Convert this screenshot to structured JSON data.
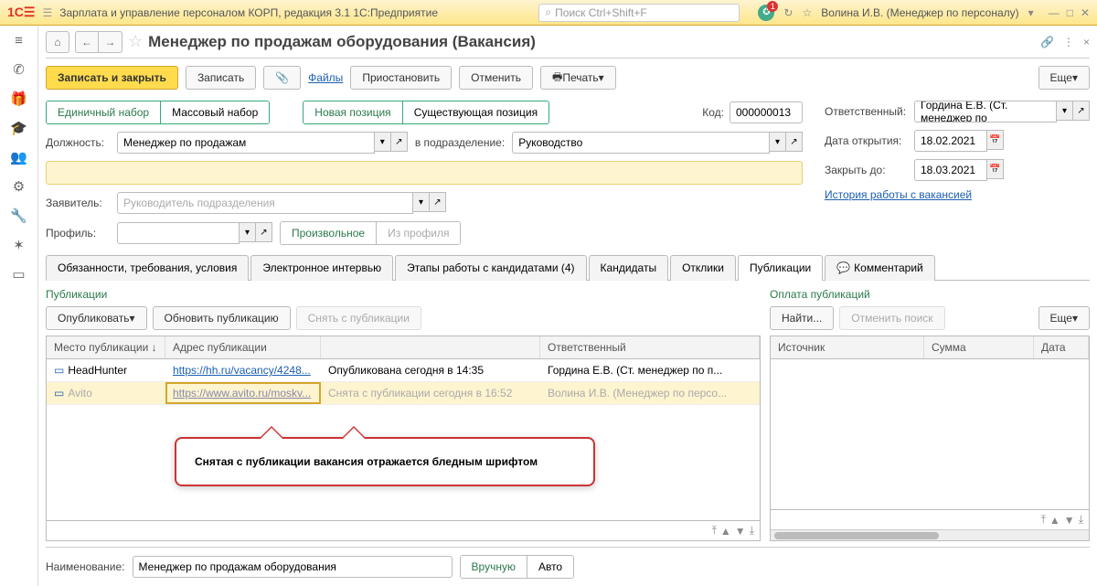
{
  "top": {
    "app_title": "Зарплата и управление персоналом КОРП, редакция 3.1 1С:Предприятие",
    "search_placeholder": "Поиск Ctrl+Shift+F",
    "bell_count": "1",
    "user": "Волина И.В. (Менеджер по персоналу)"
  },
  "page_title": "Менеджер по продажам оборудования (Вакансия)",
  "actions": {
    "save_close": "Записать и закрыть",
    "save": "Записать",
    "files": "Файлы",
    "pause": "Приостановить",
    "cancel": "Отменить",
    "print": "Печать",
    "more": "Еще"
  },
  "recruit_type": {
    "single": "Единичный набор",
    "mass": "Массовый набор"
  },
  "position_type": {
    "new": "Новая позиция",
    "existing": "Существующая позиция"
  },
  "code": {
    "label": "Код:",
    "value": "000000013"
  },
  "fields": {
    "position_lbl": "Должность:",
    "position_val": "Менеджер по продажам",
    "dept_lbl": "в подразделение:",
    "dept_val": "Руководство",
    "requester_lbl": "Заявитель:",
    "requester_ph": "Руководитель подразделения",
    "profile_lbl": "Профиль:",
    "arbitrary": "Произвольное",
    "from_profile": "Из профиля",
    "responsible_lbl": "Ответственный:",
    "responsible_val": "Гордина Е.В. (Ст. менеджер по",
    "open_date_lbl": "Дата открытия:",
    "open_date_val": "18.02.2021",
    "close_date_lbl": "Закрыть до:",
    "close_date_val": "18.03.2021",
    "history_link": "История работы с вакансией"
  },
  "tabs": {
    "t1": "Обязанности, требования, условия",
    "t2": "Электронное интервью",
    "t3": "Этапы работы с кандидатами (4)",
    "t4": "Кандидаты",
    "t5": "Отклики",
    "t6": "Публикации",
    "t7": "Комментарий"
  },
  "pub": {
    "title": "Публикации",
    "publish": "Опубликовать",
    "refresh": "Обновить публикацию",
    "unpublish": "Снять с публикации",
    "cols": {
      "place": "Место публикации",
      "addr": "Адрес публикации",
      "resp": "Ответственный"
    },
    "rows": [
      {
        "place": "HeadHunter",
        "url": "https://hh.ru/vacancy/4248...",
        "status": "Опубликована сегодня в 14:35",
        "resp": "Гордина Е.В. (Ст. менеджер по п..."
      },
      {
        "place": "Avito",
        "url": "https://www.avito.ru/moskv...",
        "status": "Снята с публикации сегодня в 16:52",
        "resp": "Волина И.В. (Менеджер по персо..."
      }
    ]
  },
  "pay": {
    "title": "Оплата публикаций",
    "find": "Найти...",
    "cancel_search": "Отменить поиск",
    "more": "Еще",
    "cols": {
      "source": "Источник",
      "sum": "Сумма",
      "date": "Дата"
    }
  },
  "callout": "Снятая с публикации вакансия отражается бледным шрифтом",
  "footer": {
    "name_lbl": "Наименование:",
    "name_val": "Менеджер по продажам оборудования",
    "manual": "Вручную",
    "auto": "Авто"
  }
}
